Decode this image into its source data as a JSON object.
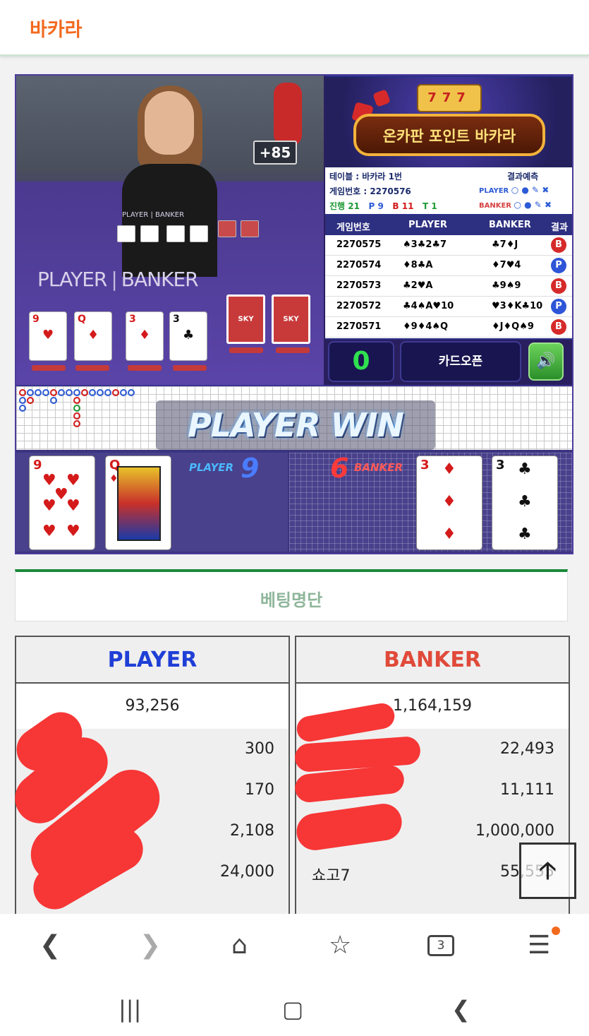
{
  "app": {
    "title": "바카라"
  },
  "video": {
    "plus_badge": "+85",
    "felt_player": "PLAYER",
    "felt_banker": "BANKER",
    "small_player": "PLAYER",
    "small_banker": "BANKER",
    "card_back_text": "SKY"
  },
  "banner": {
    "text": "온카판 포인트 바카라",
    "slot": "777"
  },
  "info": {
    "table": "테이블 : 바카라 1번",
    "game_no": "게임번호 : 2270576",
    "progress_label": "진행 21",
    "p_count": "P 9",
    "b_count": "B 11",
    "t_count": "T 1",
    "prediction_title": "결과예측",
    "pred_player": "PLAYER",
    "pred_banker": "BANKER",
    "pred_icons": "○ ● ✎ ✖"
  },
  "history": {
    "headers": [
      "게임번호",
      "PLAYER",
      "BANKER",
      "결과"
    ],
    "rows": [
      {
        "id": "2270575",
        "player": "♠3♣2♣7",
        "banker": "♣7♦J",
        "result": "B"
      },
      {
        "id": "2270574",
        "player": "♦8♣A",
        "banker": "♦7♥4",
        "result": "P"
      },
      {
        "id": "2270573",
        "player": "♣2♥A",
        "banker": "♣9♠9",
        "result": "B"
      },
      {
        "id": "2270572",
        "player": "♣4♠A♥10",
        "banker": "♥3♦K♣10",
        "result": "P"
      },
      {
        "id": "2270571",
        "player": "♦9♦4♠Q",
        "banker": "♦J♦Q♠9",
        "result": "B"
      }
    ]
  },
  "controls": {
    "counter": "0",
    "open_label": "카드오픈",
    "sound_icon": "🔊"
  },
  "result": {
    "banner": "PLAYER WIN",
    "player_label": "PLAYER",
    "player_score": "9",
    "banker_label": "BANKER",
    "banker_score": "6",
    "player_cards": [
      {
        "rank": "9",
        "suit": "♥"
      },
      {
        "rank": "Q",
        "suit": "♦"
      }
    ],
    "banker_cards": [
      {
        "rank": "3",
        "suit": "♦"
      },
      {
        "rank": "3",
        "suit": "♣"
      }
    ]
  },
  "bet_list": {
    "title": "베팅명단",
    "player": {
      "header": "PLAYER",
      "total": "93,256",
      "rows": [
        "300",
        "170",
        "2,108",
        "24,000"
      ]
    },
    "banker": {
      "header": "BANKER",
      "total": "1,164,159",
      "rows": [
        {
          "name": "",
          "amount": "22,493"
        },
        {
          "name": "",
          "amount": "11,111"
        },
        {
          "name": "",
          "amount": "1,000,000"
        },
        {
          "name": "쇼고7",
          "amount": "55,555"
        }
      ]
    }
  },
  "colors": {
    "accent": "#f26a1f",
    "player_blue": "#1f3fd6",
    "banker_red": "#e04a3a",
    "green": "#1a8a3a"
  },
  "icons": {
    "back": "chevron-left-icon",
    "forward": "chevron-right-icon",
    "home": "home-icon",
    "bookmarks": "star-list-icon",
    "tabs": "tabs-icon",
    "menu": "menu-icon",
    "scroll_top": "arrow-up-icon"
  },
  "nav": {
    "tab_count": "3"
  }
}
